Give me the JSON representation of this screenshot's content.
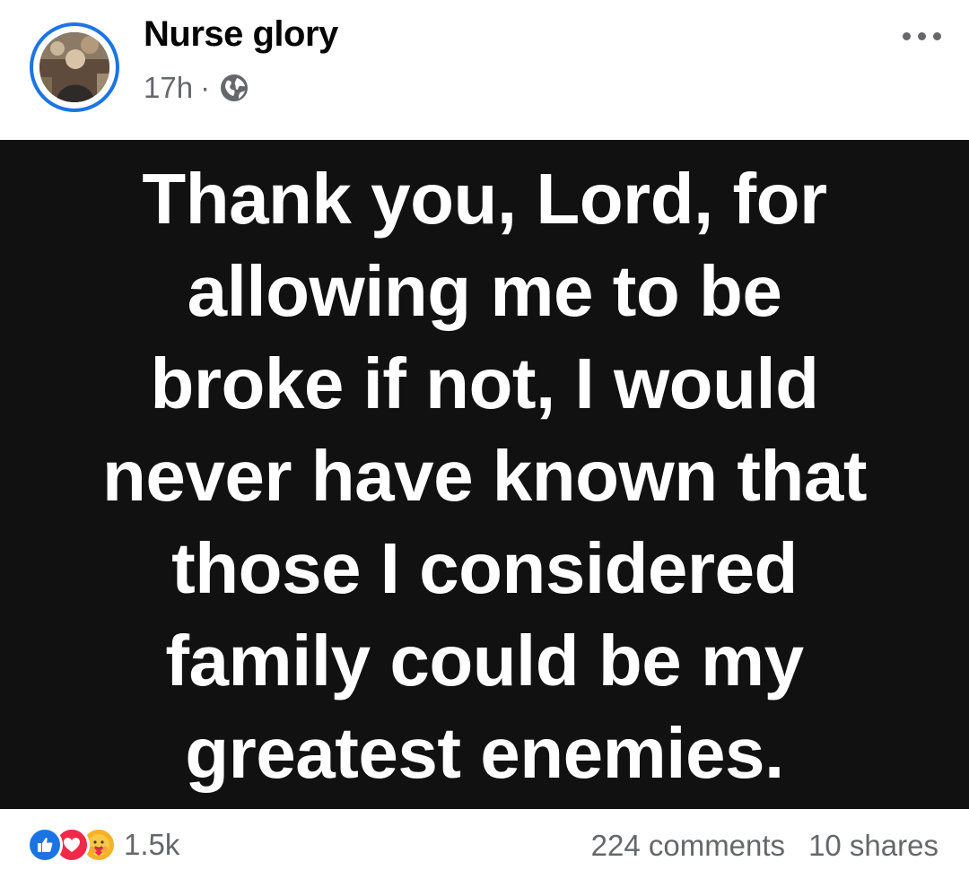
{
  "post": {
    "author": {
      "name": "Nurse glory",
      "avatar_icon": "profile-photo"
    },
    "meta": {
      "time": "17h",
      "separator": "·",
      "audience_icon": "globe-icon"
    },
    "more_icon": "more-horizontal-icon",
    "image_text": {
      "lines": [
        "Thank you, Lord, for",
        "allowing me to be",
        "broke if not, I would",
        "never have known that",
        "those I considered",
        "family could be my",
        "greatest enemies."
      ]
    },
    "footer": {
      "reaction_icons": [
        "like-icon",
        "love-icon",
        "care-icon"
      ],
      "reaction_count": "1.5k",
      "comments": "224 comments",
      "shares": "10 shares"
    }
  },
  "colors": {
    "accent": "#1b74e4",
    "image_background": "#111111",
    "image_text": "#ffffff",
    "secondary_text": "#65676b",
    "love": "#f0284a",
    "care": "#f7b125"
  }
}
